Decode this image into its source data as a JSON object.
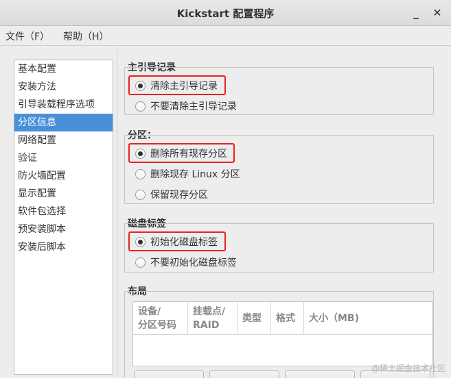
{
  "window": {
    "title": "Kickstart 配置程序",
    "minimize_glyph": "_",
    "close_glyph": "✕"
  },
  "menubar": {
    "file": "文件（F）",
    "help": "帮助（H）"
  },
  "sidebar": {
    "selected_index": 3,
    "items": [
      {
        "label": "基本配置"
      },
      {
        "label": "安装方法"
      },
      {
        "label": "引导装载程序选项"
      },
      {
        "label": "分区信息"
      },
      {
        "label": "网络配置"
      },
      {
        "label": "验证"
      },
      {
        "label": "防火墙配置"
      },
      {
        "label": "显示配置"
      },
      {
        "label": "软件包选择"
      },
      {
        "label": "预安装脚本"
      },
      {
        "label": "安装后脚本"
      }
    ]
  },
  "mbr": {
    "title": "主引导记录",
    "options": [
      {
        "label": "清除主引导记录",
        "checked": true
      },
      {
        "label": "不要清除主引导记录",
        "checked": false
      }
    ]
  },
  "partitions": {
    "title": "分区：",
    "options": [
      {
        "label": "删除所有现存分区",
        "checked": true
      },
      {
        "label": "删除现存 Linux 分区",
        "checked": false
      },
      {
        "label": "保留现存分区",
        "checked": false
      }
    ]
  },
  "disklabel": {
    "title": "磁盘标签",
    "options": [
      {
        "label": "初始化磁盘标签",
        "checked": true
      },
      {
        "label": "不要初始化磁盘标签",
        "checked": false
      }
    ]
  },
  "layout": {
    "title": "布局",
    "columns": [
      {
        "line1": "设备/",
        "line2": "分区号码"
      },
      {
        "line1": "挂载点/",
        "line2": "RAID"
      },
      {
        "line1": "类型",
        "line2": ""
      },
      {
        "line1": "格式",
        "line2": ""
      },
      {
        "line1": "大小（MB)",
        "line2": ""
      }
    ]
  },
  "watermark": "@稀土掘金技术社区",
  "colors": {
    "selection": "#4a90d9",
    "highlight_box": "#e8201f"
  }
}
